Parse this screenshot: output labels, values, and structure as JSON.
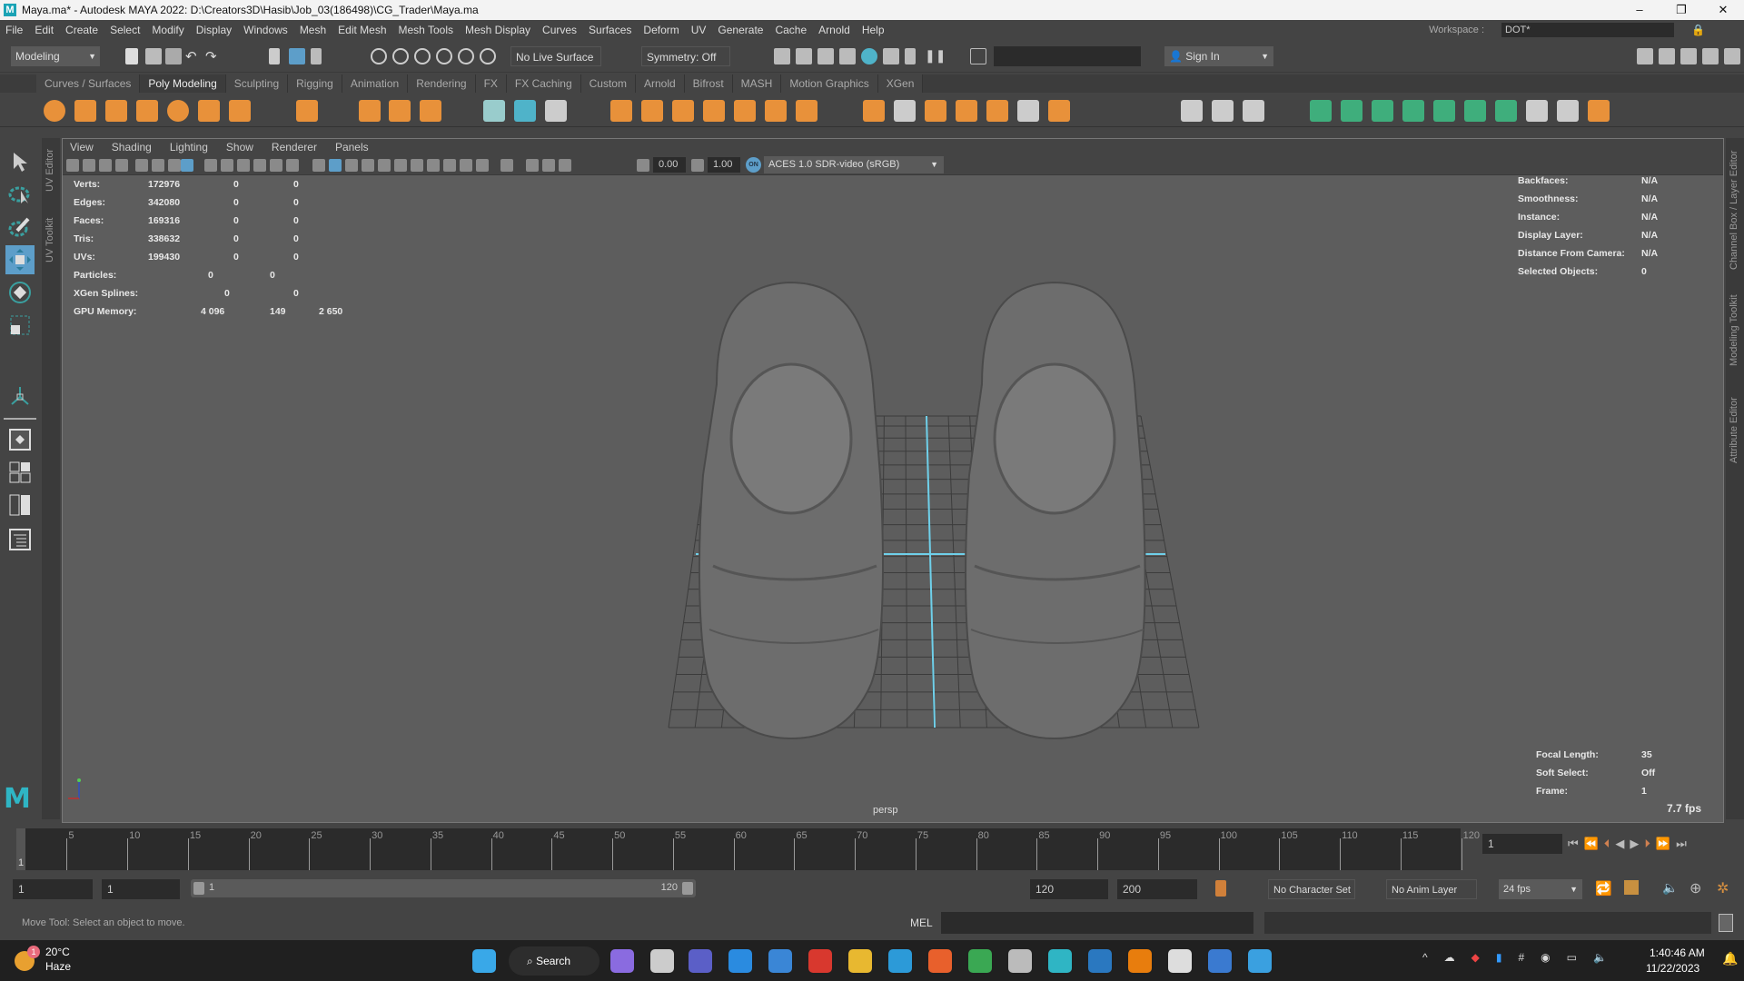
{
  "window": {
    "title": "Maya.ma* - Autodesk MAYA 2022: D:\\Creators3D\\Hasib\\Job_03(186498)\\CG_Trader\\Maya.ma",
    "logo": "M",
    "minimize": "–",
    "maximize": "❐",
    "close": "✕"
  },
  "menu": [
    "File",
    "Edit",
    "Create",
    "Select",
    "Modify",
    "Display",
    "Windows",
    "Mesh",
    "Edit Mesh",
    "Mesh Tools",
    "Mesh Display",
    "Curves",
    "Surfaces",
    "Deform",
    "UV",
    "Generate",
    "Cache",
    "Arnold",
    "Help"
  ],
  "workspace": {
    "label": "Workspace :",
    "value": "DOT*"
  },
  "statusline": {
    "mode": "Modeling",
    "live_surface": "No Live Surface",
    "symmetry": "Symmetry: Off",
    "sign_in": "Sign In"
  },
  "shelf_tabs": [
    "Curves / Surfaces",
    "Poly Modeling",
    "Sculpting",
    "Rigging",
    "Animation",
    "Rendering",
    "FX",
    "FX Caching",
    "Custom",
    "Arnold",
    "Bifrost",
    "MASH",
    "Motion Graphics",
    "XGen"
  ],
  "shelf_active": "Poly Modeling",
  "colors": {
    "accent": "#5d9ec9",
    "shelf_orange": "#e8913a",
    "shelf_green": "#3fae7c",
    "axis_blue": "#6fd0ea",
    "bg_viewport": "#5d5d5d"
  },
  "side_tabs": {
    "left": [
      "UV Editor",
      "UV Toolkit"
    ],
    "right": [
      "Channel Box / Layer Editor",
      "Modeling Toolkit",
      "Attribute Editor"
    ]
  },
  "panel_menu": [
    "View",
    "Shading",
    "Lighting",
    "Show",
    "Renderer",
    "Panels"
  ],
  "panel_bar": {
    "exposure": "0.00",
    "gamma": "1.00",
    "color_mgmt": "ACES 1.0 SDR-video (sRGB)",
    "on_label": "ON"
  },
  "hud_left": [
    {
      "label": "Verts:",
      "v": [
        "172976",
        "0",
        "0"
      ]
    },
    {
      "label": "Edges:",
      "v": [
        "342080",
        "0",
        "0"
      ]
    },
    {
      "label": "Faces:",
      "v": [
        "169316",
        "0",
        "0"
      ]
    },
    {
      "label": "Tris:",
      "v": [
        "338632",
        "0",
        "0"
      ]
    },
    {
      "label": "UVs:",
      "v": [
        "199430",
        "0",
        "0"
      ]
    },
    {
      "label": "Particles:",
      "v": [
        "",
        "0",
        "0"
      ]
    },
    {
      "label": "XGen Splines:",
      "v": [
        "",
        "0",
        "0"
      ]
    },
    {
      "label": "GPU Memory:",
      "v": [
        "4 096",
        "149",
        "2 650"
      ]
    }
  ],
  "hud_right": [
    {
      "label": "Backfaces:",
      "value": "N/A"
    },
    {
      "label": "Smoothness:",
      "value": "N/A"
    },
    {
      "label": "Instance:",
      "value": "N/A"
    },
    {
      "label": "Display Layer:",
      "value": "N/A"
    },
    {
      "label": "Distance From Camera:",
      "value": "N/A"
    },
    {
      "label": "Selected Objects:",
      "value": "0"
    }
  ],
  "hud_bottom": [
    {
      "label": "Focal Length:",
      "value": "35"
    },
    {
      "label": "Soft Select:",
      "value": "Off"
    },
    {
      "label": "Frame:",
      "value": "1"
    }
  ],
  "fps": "7.7 fps",
  "camera": "persp",
  "timeline": {
    "ticks": [
      "5",
      "10",
      "15",
      "20",
      "25",
      "30",
      "35",
      "40",
      "45",
      "50",
      "55",
      "60",
      "65",
      "70",
      "75",
      "80",
      "85",
      "90",
      "95",
      "100",
      "105",
      "110",
      "115",
      "120"
    ],
    "current": "1",
    "current_field": "1"
  },
  "range": {
    "start": "1",
    "playback_start": "1",
    "slider_start": "1",
    "slider_end": "120",
    "playback_end": "120",
    "end": "200",
    "character_set": "No Character Set",
    "anim_layer": "No Anim Layer",
    "fps": "24 fps"
  },
  "cmd": {
    "lang": "MEL",
    "help": "Move Tool: Select an object to move."
  },
  "taskbar": {
    "weather_temp": "20°C",
    "weather_desc": "Haze",
    "weather_badge": "1",
    "search": "Search",
    "time": "1:40:46 AM",
    "date": "11/22/2023"
  }
}
